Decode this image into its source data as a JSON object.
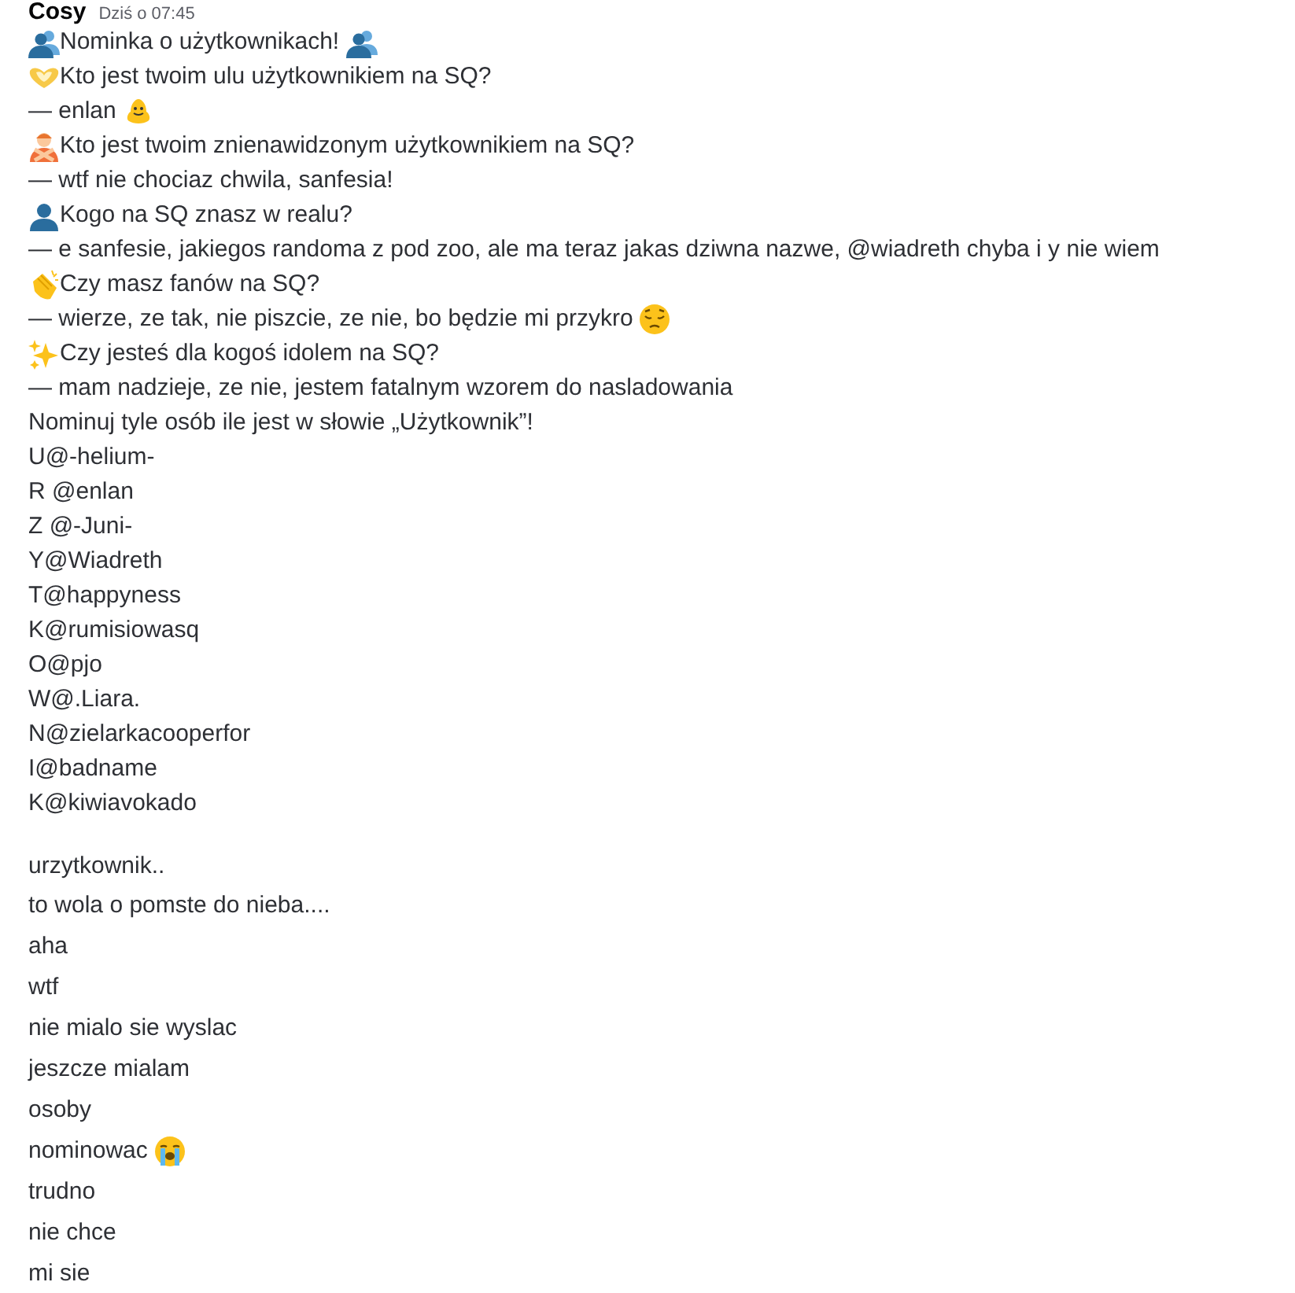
{
  "header": {
    "author": "Cosy",
    "timestamp": "Dziś o 07:45"
  },
  "first_message": [
    {
      "text": "Nominka o użytkownikach!"
    },
    {
      "text": "Kto jest twoim ulu użytkownikiem na SQ?"
    },
    {
      "text": "— enlan"
    },
    {
      "text": "Kto jest twoim znienawidzonym użytkownikiem na SQ?"
    },
    {
      "text": "— wtf nie chociaz chwila, sanfesia!"
    },
    {
      "text": "Kogo na SQ znasz w realu?"
    },
    {
      "text": "— e sanfesie, jakiegos randoma z pod zoo, ale ma teraz jakas dziwna nazwe, @wiadreth chyba i y nie wiem"
    },
    {
      "text": "Czy masz fanów na SQ?"
    },
    {
      "text": "— wierze, ze tak, nie piszcie, ze nie, bo będzie mi przykro"
    },
    {
      "text": "Czy jesteś dla kogoś idolem na SQ?"
    },
    {
      "text": "— mam nadzieje, ze nie, jestem fatalnym wzorem do nasladowania"
    },
    {
      "text": "Nominuj tyle osób ile jest w słowie „Użytkownik”!"
    },
    {
      "text": "U@-helium-"
    },
    {
      "text": "R @enlan"
    },
    {
      "text": "Z @-Juni-"
    },
    {
      "text": "Y@Wiadreth"
    },
    {
      "text": "T@happyness"
    },
    {
      "text": "K@rumisiowasq"
    },
    {
      "text": "O@pjo"
    },
    {
      "text": "W@.Liara."
    },
    {
      "text": "N@zielarkacooperfor"
    },
    {
      "text": "I@badname"
    },
    {
      "text": "K@kiwiavokado"
    }
  ],
  "followups": [
    {
      "text": "urzytkownik.."
    },
    {
      "text": "to wola o pomste do nieba...."
    },
    {
      "text": "aha"
    },
    {
      "text": "wtf"
    },
    {
      "text": "nie mialo sie wyslac"
    },
    {
      "text": "jeszcze mialam"
    },
    {
      "text": "osoby"
    },
    {
      "text": "nominowac"
    },
    {
      "text": "trudno"
    },
    {
      "text": "nie chce"
    },
    {
      "text": "mi sie"
    }
  ]
}
